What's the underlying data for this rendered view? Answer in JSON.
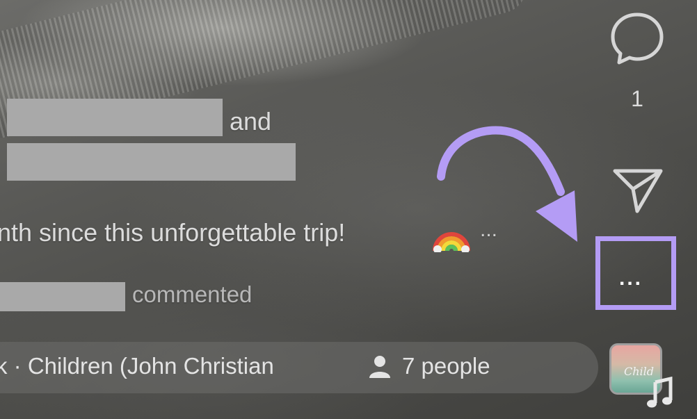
{
  "caption": {
    "joiner": "and",
    "text": "nth since this unforgettable trip!",
    "emoji": "rainbow",
    "more": "..."
  },
  "activity": {
    "action": "commented"
  },
  "music": {
    "track": "k · Children (John Christian",
    "people_count_label": "7 people"
  },
  "actions": {
    "comment_count": "1",
    "more_glyph": "..."
  },
  "album": {
    "title": "Child"
  },
  "colors": {
    "highlight": "#b49cf5",
    "redaction": "#a9a9a9"
  },
  "icons": [
    "comment-icon",
    "send-icon",
    "more-icon",
    "person-icon",
    "music-note-icon",
    "annotation-arrow"
  ]
}
